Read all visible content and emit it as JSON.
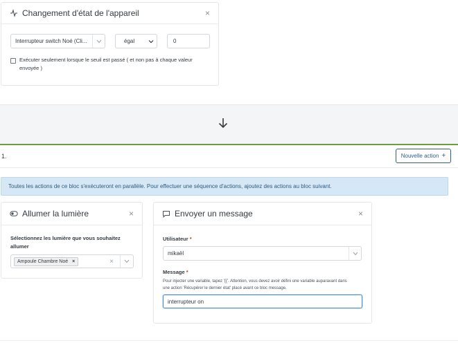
{
  "trigger_card": {
    "title": "Changement d'état de l'appareil",
    "device_select": "Interrupteur switch Noé (Cli...",
    "operator_select": "égal",
    "value_input": "0",
    "checkbox_label_line1": "Exécuter seulement lorsque le seuil est passé ( et non pas à chaque valeur",
    "checkbox_label_line2": "envoyée )",
    "close": "×"
  },
  "arrow": "↓",
  "section": {
    "number": "1.",
    "new_action_button": "Nouvelle action",
    "new_action_plus": "+"
  },
  "info_text": "Toutes les actions de ce bloc s'exécuteront en parallèle. Pour effectuer une séquence d'actions, ajoutez des actions au bloc suivant.",
  "light_card": {
    "title": "Allumer la lumière",
    "close": "×",
    "label_line1": "Sélectionnez les lumière que vous souhaitez",
    "label_line2": "allumer",
    "tag": "Ampoule Chambre Noé",
    "tag_remove": "×",
    "clear": "×"
  },
  "message_card": {
    "title": "Envoyer un message",
    "close": "×",
    "user_label": "Utilisateur",
    "user_required": "*",
    "user_value": "mikaël",
    "message_label": "Message",
    "message_required": "*",
    "help_line1": "Pour injecter une variable, tapez '{{'. Attention, vous devez avoir défini une variable auparavant dans",
    "help_line2": "une action 'Récupérer le dernier état' placé avant ce bloc message.",
    "message_value": "interrupteur on"
  }
}
